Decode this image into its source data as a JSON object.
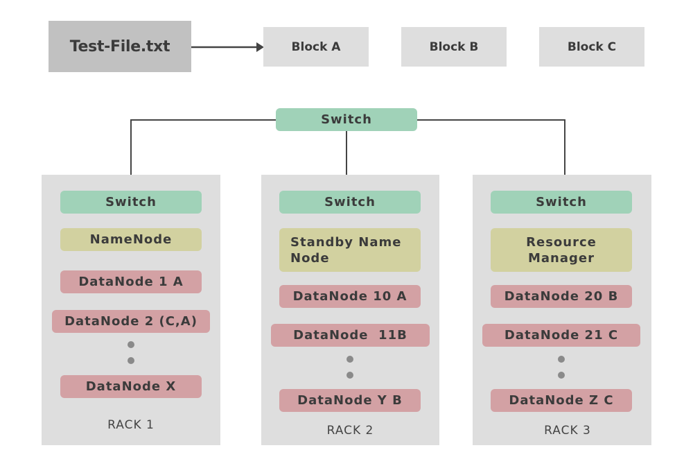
{
  "file": {
    "label": "Test-File.txt"
  },
  "blocks": [
    {
      "label": "Block A"
    },
    {
      "label": "Block B"
    },
    {
      "label": "Block C"
    }
  ],
  "core_switch": {
    "label": "Switch"
  },
  "racks": [
    {
      "label": "RACK 1",
      "switch": "Switch",
      "manager": "NameNode",
      "datanodes": [
        "DataNode 1 A",
        "DataNode 2 (C,A)",
        "DataNode X"
      ]
    },
    {
      "label": "RACK 2",
      "switch": "Switch",
      "manager": "Standby Name Node",
      "datanodes": [
        "DataNode 10 A",
        "DataNode  11B",
        "DataNode Y B"
      ]
    },
    {
      "label": "RACK 3",
      "switch": "Switch",
      "manager": "Resource Manager",
      "datanodes": [
        "DataNode 20 B",
        "DataNode 21 C",
        "DataNode Z C"
      ]
    }
  ],
  "colors": {
    "file": "#c1c1c1",
    "block": "#dedede",
    "rack": "#dedede",
    "switch": "#a0d2b8",
    "manager": "#d2d1a0",
    "datanode": "#d3a1a4",
    "line": "#444444",
    "dots": "#8a8a8a"
  }
}
